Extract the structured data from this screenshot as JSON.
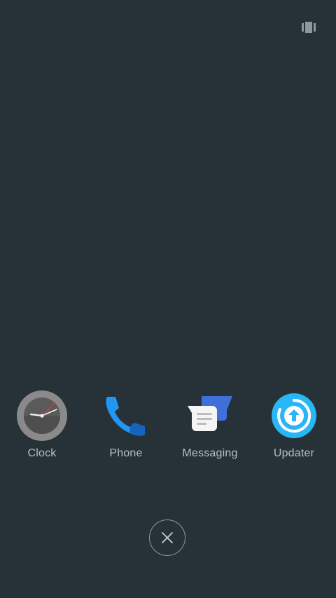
{
  "toolbar": {
    "layout_icon": "view-carousel-icon"
  },
  "apps": [
    {
      "label": "Clock",
      "icon": "clock-icon"
    },
    {
      "label": "Phone",
      "icon": "phone-icon"
    },
    {
      "label": "Messaging",
      "icon": "messaging-icon"
    },
    {
      "label": "Updater",
      "icon": "updater-icon"
    }
  ],
  "dismiss": {
    "icon": "close-icon"
  },
  "colors": {
    "background": "#263238",
    "label": "#b9bfc2",
    "phone_blue": "#2196f3",
    "updater_blue": "#29b6f6",
    "messaging_blue": "#3f6fd8"
  }
}
